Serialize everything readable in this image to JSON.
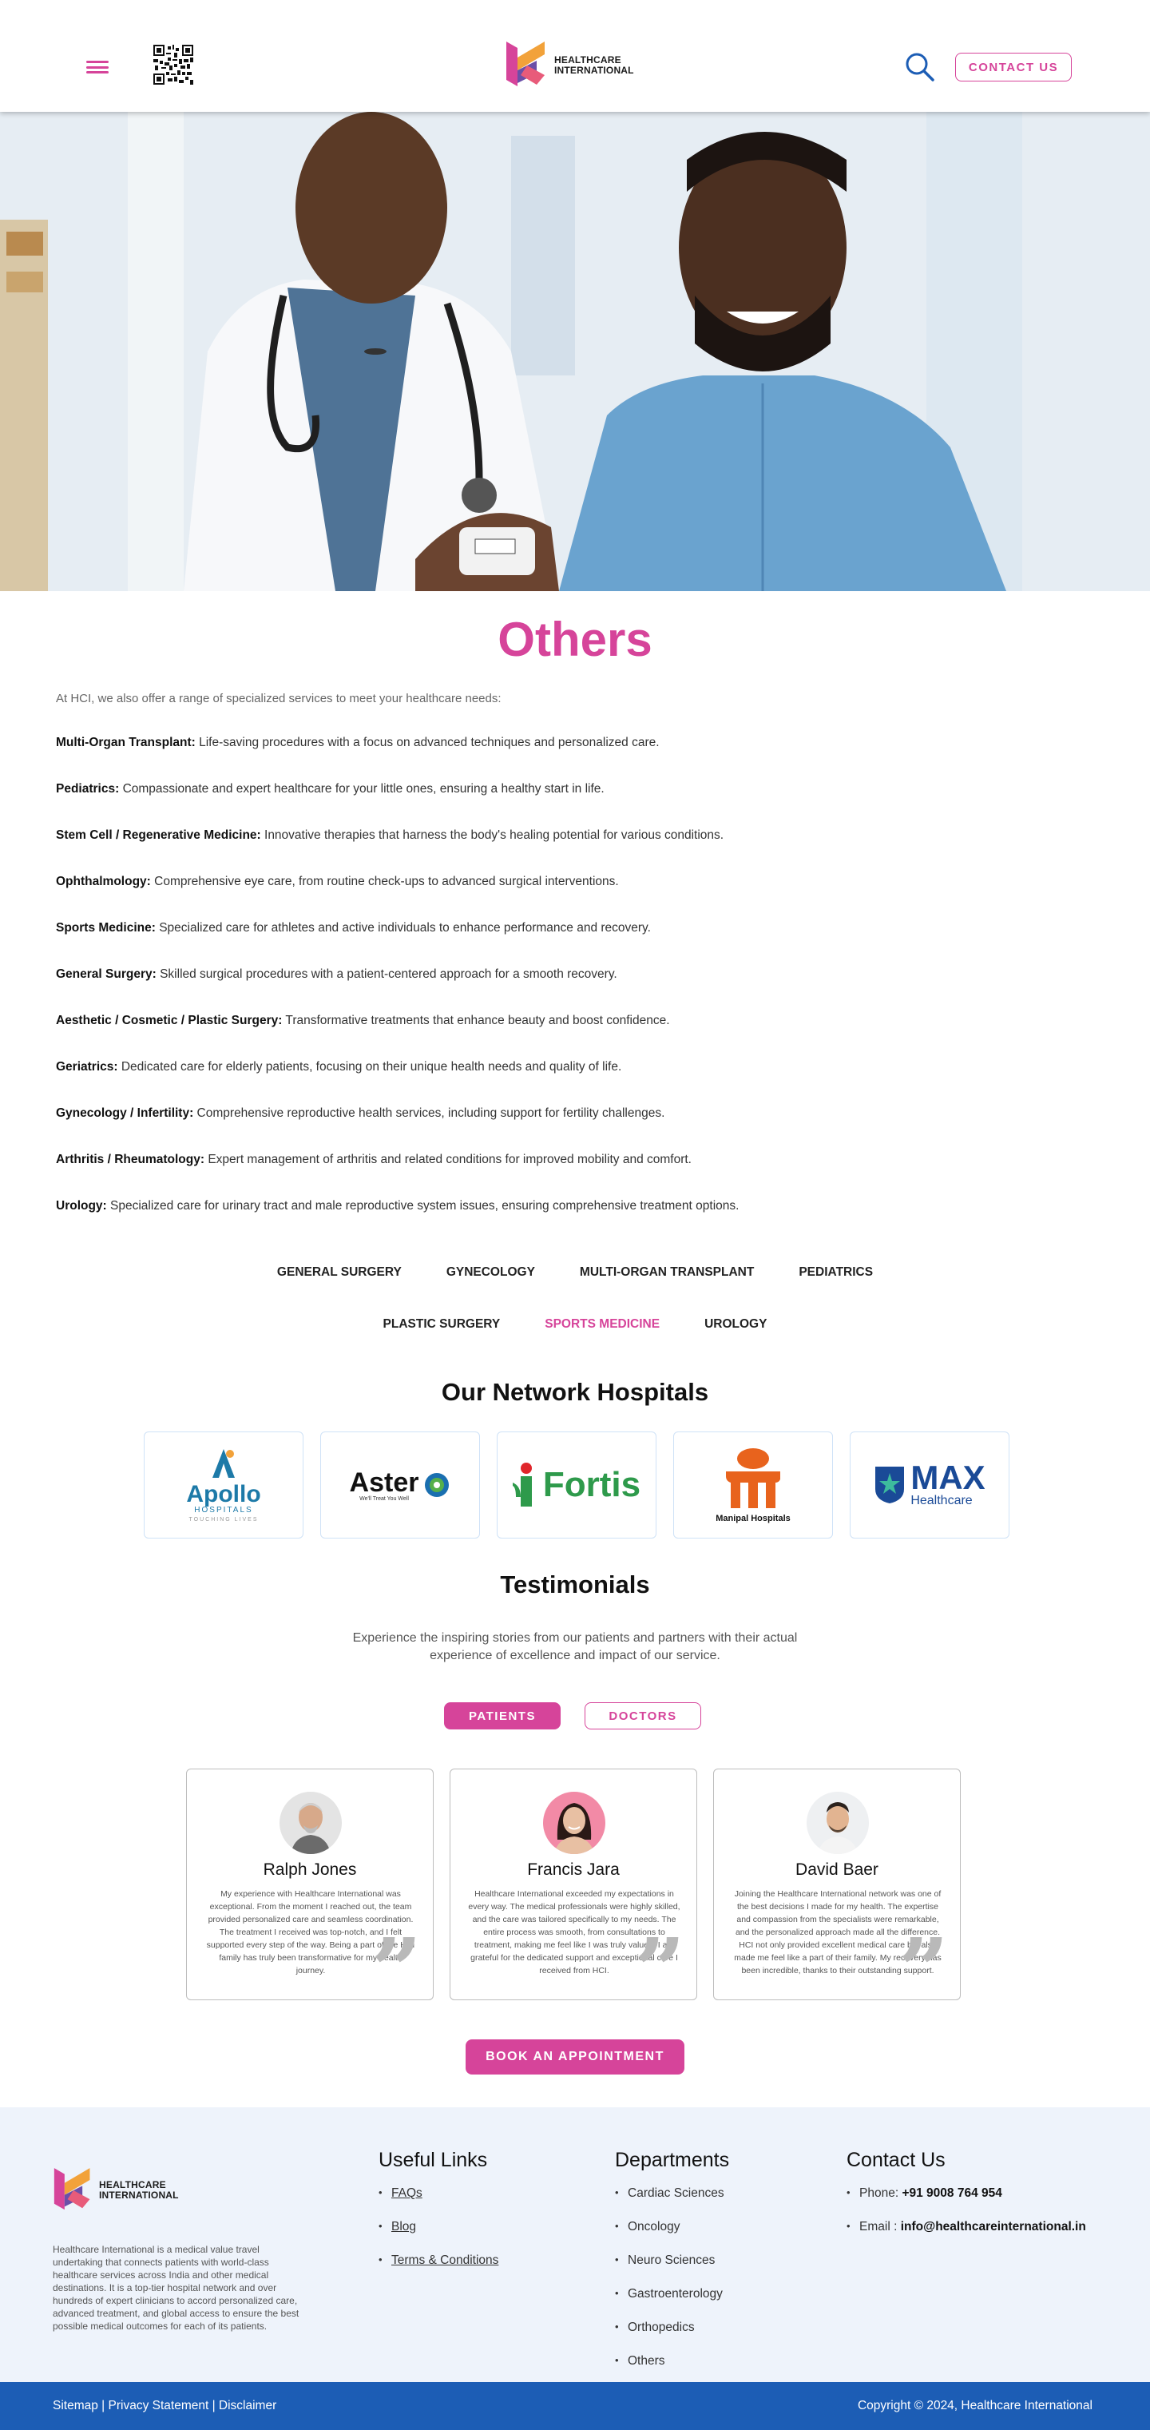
{
  "header": {
    "logo_line1": "HEALTHCARE",
    "logo_line2": "INTERNATIONAL",
    "contact_label": "CONTACT US"
  },
  "others": {
    "title": "Others",
    "intro": "At HCI, we also offer a range of specialized services to meet your healthcare needs:",
    "services": [
      {
        "name": "Multi-Organ Transplant:",
        "desc": " Life-saving procedures with a focus on advanced techniques and personalized care."
      },
      {
        "name": "Pediatrics:",
        "desc": " Compassionate and expert healthcare for your little ones, ensuring a healthy start in life."
      },
      {
        "name": "Stem Cell / Regenerative Medicine:",
        "desc": " Innovative therapies that harness the body's healing potential for various conditions."
      },
      {
        "name": "Ophthalmology:",
        "desc": " Comprehensive eye care, from routine check-ups to advanced surgical interventions."
      },
      {
        "name": "Sports Medicine:",
        "desc": " Specialized care for athletes and active individuals to enhance performance and recovery."
      },
      {
        "name": "General Surgery:",
        "desc": " Skilled surgical procedures with a patient-centered approach for a smooth recovery."
      },
      {
        "name": "Aesthetic / Cosmetic / Plastic Surgery:",
        "desc": " Transformative treatments that enhance beauty and boost confidence."
      },
      {
        "name": "Geriatrics:",
        "desc": " Dedicated care for elderly patients, focusing on their unique health needs and quality of life."
      },
      {
        "name": "Gynecology / Infertility:",
        "desc": " Comprehensive reproductive health services, including support for fertility challenges."
      },
      {
        "name": "Arthritis / Rheumatology:",
        "desc": " Expert management of arthritis and related conditions for improved mobility and comfort."
      },
      {
        "name": "Urology:",
        "desc": " Specialized care for urinary tract and male reproductive system issues, ensuring comprehensive treatment options."
      }
    ]
  },
  "tabs_row1": [
    "GENERAL SURGERY",
    "GYNECOLOGY",
    "MULTI-ORGAN TRANSPLANT",
    "PEDIATRICS"
  ],
  "tabs_row2": [
    "PLASTIC SURGERY",
    "SPORTS MEDICINE",
    "UROLOGY"
  ],
  "network": {
    "title": "Our Network Hospitals",
    "apollo": "Apollo",
    "apollo_sub": "HOSPITALS",
    "apollo_tag": "TOUCHING LIVES",
    "aster": "Aster",
    "aster_tag": "We'll Treat You Well",
    "fortis": "Fortis",
    "manipal": "Manipal Hospitals",
    "max": "MAX",
    "max_sub": "Healthcare"
  },
  "testimonials": {
    "title": "Testimonials",
    "subtitle": "Experience the inspiring stories from our patients and partners with their actual experience of excellence and impact of our service.",
    "tab_patients": "PATIENTS",
    "tab_doctors": "DOCTORS",
    "items": [
      {
        "name": "Ralph Jones",
        "text": "My experience with Healthcare International was exceptional. From the moment I reached out, the team provided personalized care and seamless coordination. The treatment I received was top-notch, and I felt supported every step of the way. Being a part of the HCI family has truly been transformative for my health journey."
      },
      {
        "name": "Francis Jara",
        "text": "Healthcare International exceeded my expectations in every way. The medical professionals were highly skilled, and the care was tailored specifically to my needs. The entire process was smooth, from consultations to treatment, making me feel like I was truly valued. I am grateful for the dedicated support and exceptional care I received from HCI."
      },
      {
        "name": "David Baer",
        "text": "Joining the Healthcare International network was one of the best decisions I made for my health. The expertise and compassion from the specialists were remarkable, and the personalized approach made all the difference. HCI not only provided excellent medical care but also made me feel like a part of their family. My recovery has been incredible, thanks to their outstanding support."
      }
    ],
    "book_label": "BOOK AN APPOINTMENT"
  },
  "footer": {
    "logo_line1": "HEALTHCARE",
    "logo_line2": "INTERNATIONAL",
    "about": "Healthcare International is a medical value travel undertaking that connects patients with world-class healthcare services across India and other medical destinations. It is a top-tier hospital network and over hundreds of expert clinicians to accord personalized care, advanced treatment, and global access to ensure the best possible medical outcomes for each of its patients.",
    "useful_title": "Useful Links",
    "useful": [
      "FAQs",
      "Blog",
      "Terms & Conditions"
    ],
    "dept_title": "Departments",
    "departments": [
      "Cardiac Sciences",
      "Oncology",
      "Neuro Sciences",
      "Gastroenterology",
      "Orthopedics",
      "Others"
    ],
    "contact_title": "Contact Us",
    "phone_label": "Phone: ",
    "phone": "+91 9008 764 954",
    "email_label": "Email : ",
    "email": "info@healthcareinternational.in"
  },
  "bottom": {
    "left": "Sitemap | Privacy Statement | Disclaimer",
    "right": "Copyright © 2024, Healthcare International"
  },
  "colors": {
    "accent": "#d6449a",
    "footer_bar": "#1c5db5",
    "footer_bg": "#eef3fb"
  }
}
